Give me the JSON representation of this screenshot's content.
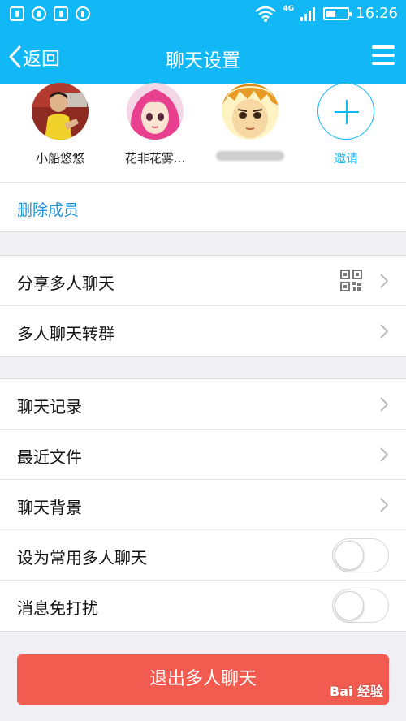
{
  "status_bar": {
    "network": "4G",
    "time": "16:26",
    "battery_level": 0.45
  },
  "nav": {
    "back_label": "返回",
    "title": "聊天设置",
    "menu_icon": "hamburger-menu-icon"
  },
  "members": [
    {
      "name": "小船悠悠",
      "avatar": "child-photo"
    },
    {
      "name": "花非花雾...",
      "avatar": "pink-hair-girl"
    },
    {
      "name": "",
      "avatar": "cartoon-boy",
      "name_blurred": true
    }
  ],
  "invite": {
    "label": "邀请",
    "icon": "plus-icon"
  },
  "remove_members": {
    "label": "删除成员"
  },
  "group1": [
    {
      "label": "分享多人聊天",
      "icon": "qr-code-icon"
    },
    {
      "label": "多人聊天转群"
    }
  ],
  "group2": [
    {
      "label": "聊天记录"
    },
    {
      "label": "最近文件"
    },
    {
      "label": "聊天背景"
    },
    {
      "label": "设为常用多人聊天",
      "toggle": false
    },
    {
      "label": "消息免打扰",
      "toggle": false
    }
  ],
  "exit_button": {
    "label": "退出多人聊天"
  },
  "watermark": "Bai 经验",
  "colors": {
    "accent": "#12b7f5",
    "danger": "#f25b50",
    "link": "#1a8fd5",
    "background": "#efeff4"
  }
}
